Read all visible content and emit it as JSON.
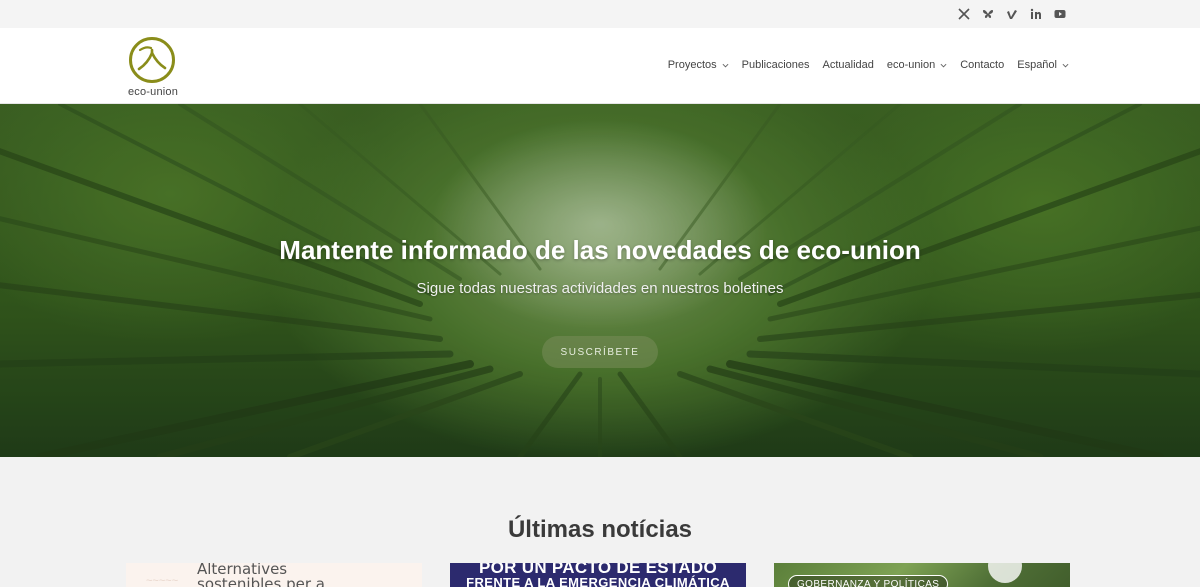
{
  "topbar": {
    "social": [
      {
        "icon": "x-twitter-icon"
      },
      {
        "icon": "bluesky-icon"
      },
      {
        "icon": "vimeo-icon"
      },
      {
        "icon": "linkedin-icon"
      },
      {
        "icon": "youtube-icon"
      }
    ]
  },
  "header": {
    "logo_text": "eco-union",
    "brand_color": "#8a8d1a",
    "nav": [
      {
        "label": "Proyectos",
        "has_dropdown": true
      },
      {
        "label": "Publicaciones",
        "has_dropdown": false
      },
      {
        "label": "Actualidad",
        "has_dropdown": false
      },
      {
        "label": "eco-union",
        "has_dropdown": true
      },
      {
        "label": "Contacto",
        "has_dropdown": false
      },
      {
        "label": "Español",
        "has_dropdown": true
      }
    ]
  },
  "hero": {
    "title": "Mantente informado de las novedades de eco-union",
    "subtitle": "Sigue todas nuestras actividades en nuestros boletines",
    "button": "SUSCRÍBETE"
  },
  "news": {
    "title": "Últimas notícias",
    "cards": [
      {
        "text_line1": "Alternatives",
        "text_line2": "sostenibles per a"
      },
      {
        "headline_line1": "POR UN PACTO DE ESTADO",
        "headline_line2": "FRENTE A LA EMERGENCIA CLIMÁTICA"
      },
      {
        "tag": "GOBERNANZA Y POLÍTICAS"
      }
    ]
  }
}
